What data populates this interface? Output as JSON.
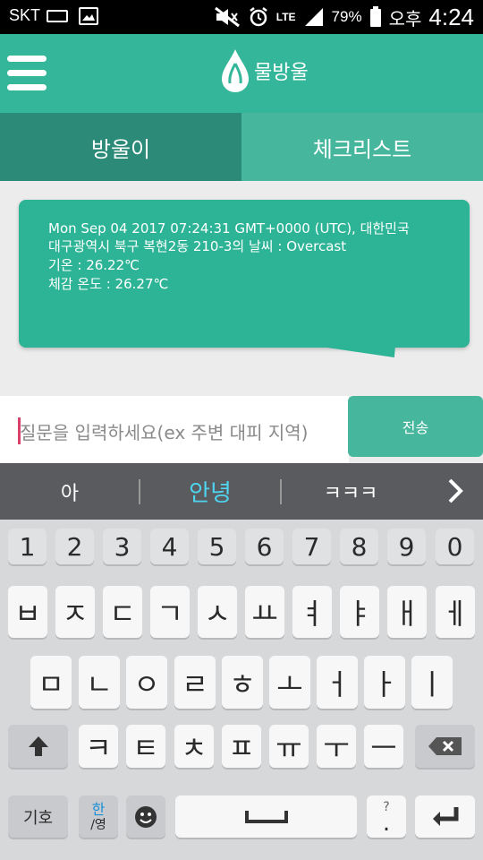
{
  "status_bar": {
    "carrier": "SKT",
    "battery": "79%",
    "ampm": "오후",
    "time": "4:24",
    "network": "LTE",
    "icons": [
      "keyboard-icon",
      "image-icon",
      "mute-icon",
      "alarm-icon",
      "signal-icon",
      "battery-icon"
    ]
  },
  "app_bar": {
    "menu_icon": "hamburger-icon",
    "logo_text": "물방울",
    "accent": "#34b69b"
  },
  "tabs": [
    {
      "label": "방울이",
      "active": true
    },
    {
      "label": "체크리스트",
      "active": false
    }
  ],
  "weather_card": {
    "lines": [
      "Mon Sep 04 2017 07:24:31 GMT+0000 (UTC), 대한민국",
      "대구광역시 북구 복현2동 210-3의 날씨 : Overcast",
      "기온 : 26.22℃",
      "체감 온도 : 26.27℃"
    ]
  },
  "question_input": {
    "placeholder": "질문을 입력하세요(ex 주변 대피 지역)"
  },
  "send_button": {
    "label": "전송"
  },
  "keyboard": {
    "suggestions": [
      "아",
      "안녕",
      "ㅋㅋㅋ"
    ],
    "number_row": [
      "1",
      "2",
      "3",
      "4",
      "5",
      "6",
      "7",
      "8",
      "9",
      "0"
    ],
    "row1": [
      "ㅂ",
      "ㅈ",
      "ㄷ",
      "ㄱ",
      "ㅅ",
      "ㅛ",
      "ㅕ",
      "ㅑ",
      "ㅐ",
      "ㅔ"
    ],
    "row2": [
      "ㅁ",
      "ㄴ",
      "ㅇ",
      "ㄹ",
      "ㅎ",
      "ㅗ",
      "ㅓ",
      "ㅏ",
      "ㅣ"
    ],
    "row3": [
      "ㅋ",
      "ㅌ",
      "ㅊ",
      "ㅍ",
      "ㅠ",
      "ㅜ",
      "ㅡ"
    ],
    "symbols_key": "기호",
    "lang_key_top": "한",
    "lang_key_bottom": "/영",
    "period_key": ".",
    "period_hint": "?",
    "space_icon": "space-icon",
    "enter_icon": "enter-icon",
    "shift_icon": "shift-icon",
    "backspace_icon": "backspace-icon",
    "emoji_icon": "emoji-icon"
  }
}
